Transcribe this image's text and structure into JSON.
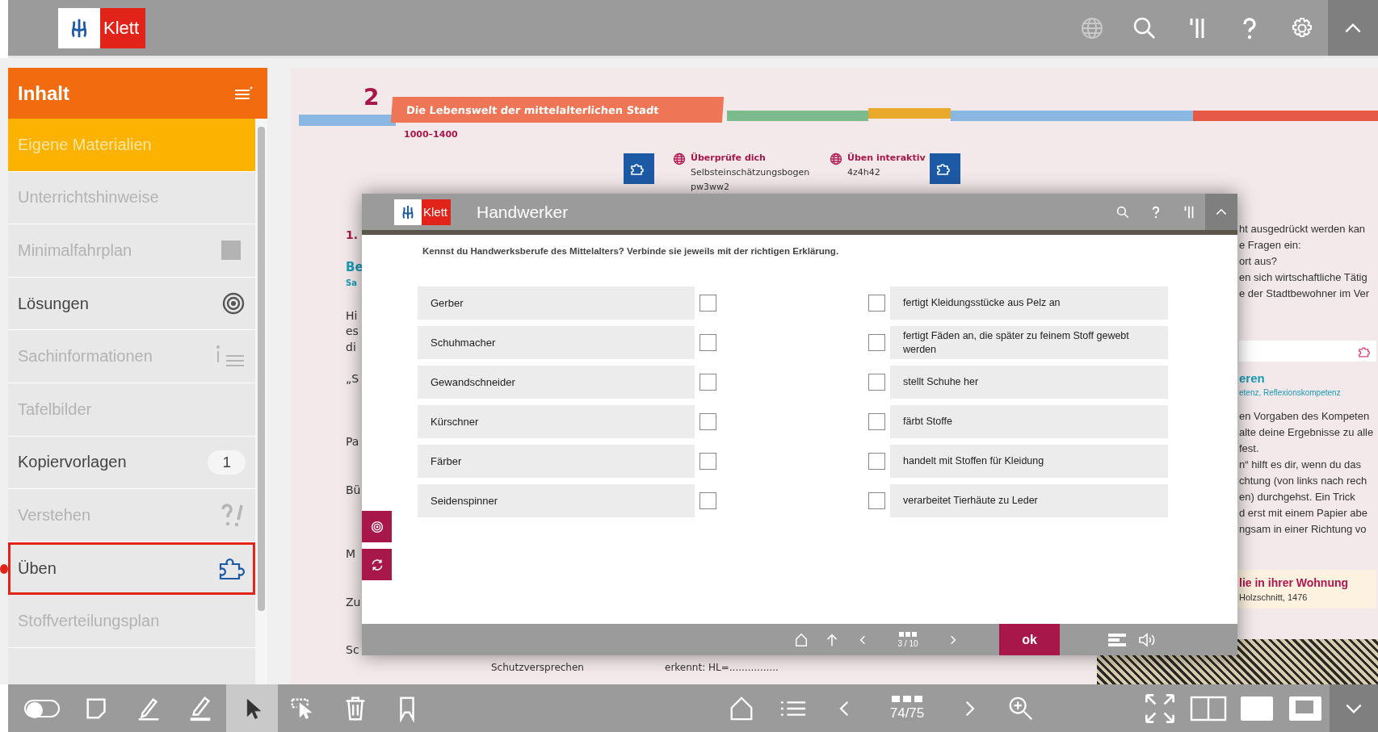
{
  "app_bar": {
    "logo": "Klett"
  },
  "sidebar": {
    "title": "Inhalt",
    "items": [
      {
        "label": "Eigene Materialien",
        "kind": "plain",
        "enabled": true,
        "selected": true,
        "highlighted": false
      },
      {
        "label": "Unterrichtshinweise",
        "kind": "plain",
        "enabled": false,
        "selected": false,
        "highlighted": false
      },
      {
        "label": "Minimalfahrplan",
        "kind": "square",
        "enabled": false,
        "selected": false,
        "highlighted": false
      },
      {
        "label": "Lösungen",
        "kind": "target",
        "enabled": true,
        "selected": false,
        "highlighted": false
      },
      {
        "label": "Sachinformationen",
        "kind": "info",
        "enabled": false,
        "selected": false,
        "highlighted": false
      },
      {
        "label": "Tafelbilder",
        "kind": "plain",
        "enabled": false,
        "selected": false,
        "highlighted": false
      },
      {
        "label": "Kopiervorlagen",
        "kind": "count",
        "badge": "1",
        "enabled": true,
        "selected": false,
        "highlighted": false
      },
      {
        "label": "Verstehen",
        "kind": "hint",
        "enabled": false,
        "selected": false,
        "highlighted": false
      },
      {
        "label": "Üben",
        "kind": "puzzle",
        "enabled": true,
        "selected": false,
        "highlighted": true
      },
      {
        "label": "Stoffverteilungsplan",
        "kind": "plain",
        "enabled": false,
        "selected": false,
        "highlighted": false
      }
    ]
  },
  "page": {
    "chapter_number": "2",
    "chapter_title": "Die Lebenswelt der mittelalterlichen Stadt",
    "period": "1000–1400",
    "links": [
      {
        "title": "Überprüfe dich",
        "lines": [
          "Selbsteinschätzungsbogen",
          "pw3ww2"
        ]
      },
      {
        "title": "Üben interaktiv",
        "lines": [
          "4z4h42"
        ]
      }
    ],
    "left_fragments": [
      {
        "text": "1.",
        "kind": "number"
      },
      {
        "text": "Be",
        "kind": "heading"
      },
      {
        "text": "Sa",
        "kind": "subheading"
      },
      {
        "text": "Hi",
        "kind": "body"
      },
      {
        "text": "es",
        "kind": "body"
      },
      {
        "text": "di",
        "kind": "body"
      },
      {
        "text": "„S",
        "kind": "body"
      },
      {
        "text": "Pa",
        "kind": "body"
      },
      {
        "text": "Bü",
        "kind": "body"
      },
      {
        "text": "M",
        "kind": "body"
      },
      {
        "text": "Zu",
        "kind": "body"
      },
      {
        "text": "Sc",
        "kind": "body"
      }
    ],
    "right_top": [
      "ht ausgedrückt werden kan",
      "e Fragen ein:",
      "ort aus?",
      "en sich wirtschaftliche Tätig",
      "e der Stadtbewohner im Ver"
    ],
    "section_title": "eren",
    "section_subtitle": "etenz, Reflexionskompetenz",
    "right_bottom": [
      "en Vorgaben des Kompeten",
      "alte deine Ergebnisse zu alle",
      "fest.",
      "n“ hilft es dir, wenn du das",
      "chtung (von links nach rech",
      "en) durchgehst. Ein Trick",
      "d erst mit einem Papier abe",
      "ngsam in einer Richtung vo"
    ],
    "caption_title": "lie in ihrer Wohnung",
    "caption": "Holzschnitt, 1476",
    "bottom_fragments": [
      "Schutzversprechen",
      "erkennt: HL=................"
    ]
  },
  "exercise": {
    "logo": "Klett",
    "title": "Handwerker",
    "instruction": "Kennst du Handwerksberufe des Mittelalters? Verbinde sie jeweils mit der richtigen Erklärung.",
    "terms": [
      {
        "label": "Gerber",
        "checked": false
      },
      {
        "label": "Schuhmacher",
        "checked": false
      },
      {
        "label": "Gewandschneider",
        "checked": false
      },
      {
        "label": "Kürschner",
        "checked": false
      },
      {
        "label": "Färber",
        "checked": false
      },
      {
        "label": "Seidenspinner",
        "checked": false
      }
    ],
    "definitions": [
      {
        "label": "fertigt Kleidungsstücke aus Pelz an",
        "checked": false
      },
      {
        "label": "fertigt Fäden an, die später zu feinem Stoff gewebt werden",
        "checked": false
      },
      {
        "label": "stellt Schuhe her",
        "checked": false
      },
      {
        "label": "färbt Stoffe",
        "checked": false
      },
      {
        "label": "handelt mit Stoffen für Kleidung",
        "checked": false
      },
      {
        "label": "verarbeitet Tierhäute zu Leder",
        "checked": false
      }
    ],
    "pagination": "3 / 10",
    "ok_label": "ok"
  },
  "toolbar": {
    "toggle_on": false,
    "tools": [
      {
        "kind": "note",
        "selected": false
      },
      {
        "kind": "pen",
        "selected": false
      },
      {
        "kind": "marker",
        "selected": false
      },
      {
        "kind": "pointer",
        "selected": true
      },
      {
        "kind": "lasso",
        "selected": false
      },
      {
        "kind": "trash",
        "selected": false
      },
      {
        "kind": "bookmark",
        "selected": false
      }
    ],
    "page_indicator": "74/75"
  }
}
